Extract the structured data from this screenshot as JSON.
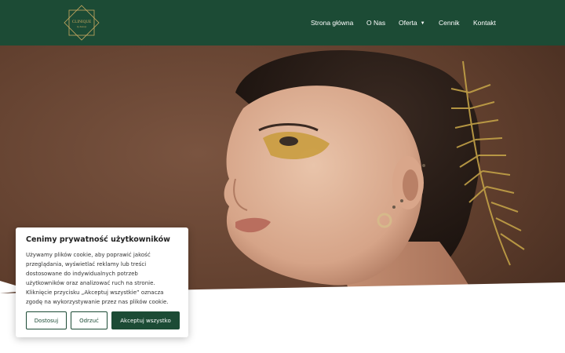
{
  "header": {
    "logo": {
      "text": "CLINIQUE",
      "subtext": "by beauty",
      "color": "#c9a961"
    },
    "nav": [
      {
        "label": "Strona główna"
      },
      {
        "label": "O Nas"
      },
      {
        "label": "Oferta",
        "icon": "caret-down-icon"
      },
      {
        "label": "Cennik"
      },
      {
        "label": "Kontakt"
      }
    ],
    "background": "#1c4b35"
  },
  "hero": {
    "image": "portrait-woman-gold-glitter-makeup",
    "background": "#6f4a36"
  },
  "cookie_banner": {
    "title": "Cenimy prywatność użytkowników",
    "lines": [
      "Używamy plików cookie, aby poprawić jakość",
      "przeglądania, wyświetlać reklamy lub treści",
      "dostosowane do indywidualnych potrzeb",
      "użytkowników oraz analizować ruch na stronie.",
      "Kliknięcie przycisku „Akceptuj wszystkie” oznacza",
      "zgodę na wykorzystywanie przez nas plików cookie."
    ],
    "buttons": {
      "customize": "Dostosuj",
      "reject": "Odrzuć",
      "accept": "Akceptuj wszystko"
    }
  }
}
